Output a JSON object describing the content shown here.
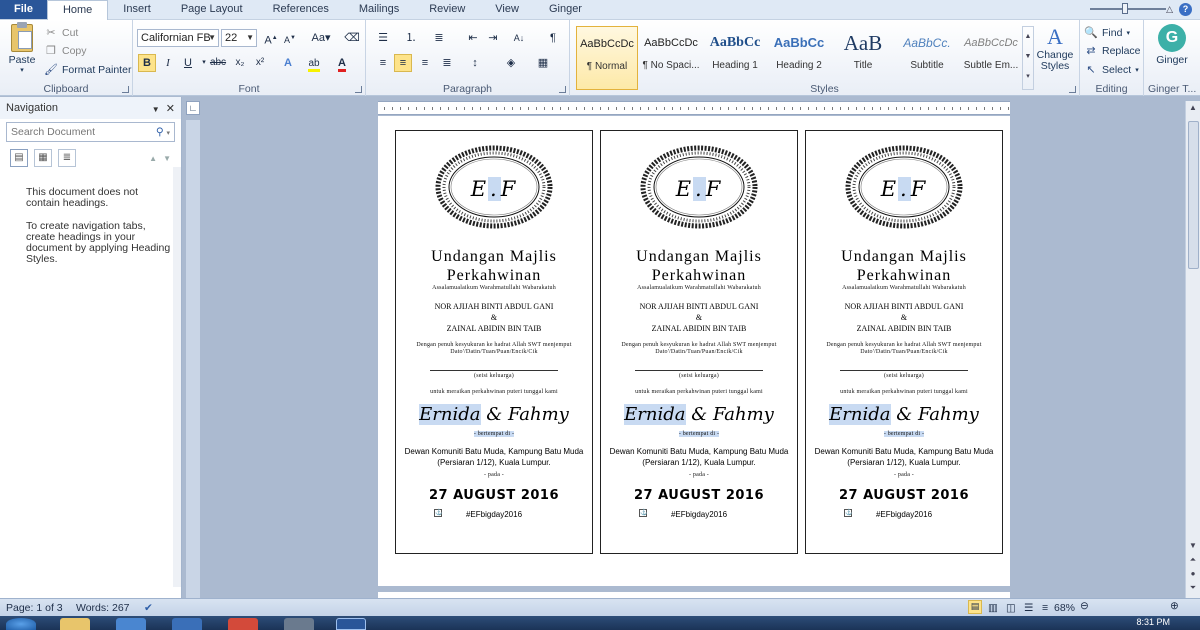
{
  "ribbon_tabs": [
    "File",
    "Home",
    "Insert",
    "Page Layout",
    "References",
    "Mailings",
    "Review",
    "View",
    "Ginger"
  ],
  "active_tab": "Home",
  "clipboard": {
    "paste": "Paste",
    "cut": "Cut",
    "copy": "Copy",
    "format_painter": "Format Painter",
    "label": "Clipboard"
  },
  "font": {
    "family": "Californian FB",
    "size": "22",
    "label": "Font"
  },
  "paragraph": {
    "label": "Paragraph"
  },
  "styles": {
    "label": "Styles",
    "items": [
      {
        "preview": "AaBbCcDc",
        "name": "¶ Normal"
      },
      {
        "preview": "AaBbCcDc",
        "name": "¶ No Spaci..."
      },
      {
        "preview": "AaBbCc",
        "name": "Heading 1"
      },
      {
        "preview": "AaBbCc",
        "name": "Heading 2"
      },
      {
        "preview": "AaB",
        "name": "Title"
      },
      {
        "preview": "AaBbCc.",
        "name": "Subtitle"
      },
      {
        "preview": "AaBbCcDc",
        "name": "Subtle Em..."
      }
    ],
    "change_styles": "Change Styles"
  },
  "editing": {
    "find": "Find",
    "replace": "Replace",
    "select": "Select",
    "label": "Editing"
  },
  "ginger": {
    "button": "Ginger",
    "label": "Ginger T..."
  },
  "navigation": {
    "title": "Navigation",
    "search_placeholder": "Search Document",
    "msg1": "This document does not contain headings.",
    "msg2": "To create navigation tabs, create headings in your document by applying Heading Styles."
  },
  "card": {
    "initials_left": "E",
    "initials_right": "F",
    "title1": "Undangan Majlis",
    "title2": "Perkahwinan",
    "greeting": "Assalamualaikum   Warahmatullahi   Wabarakatuh",
    "name1": "NOR AJIJAH BINTI ABDUL GANI",
    "amp": "&",
    "name2": "ZAINAL ABIDIN BIN TAIB",
    "invite_text": "Dengan penuh kesyukuran ke hadrat Allah SWT menjemput Dato'/Datin/Tuan/Puan/Encik/Cik",
    "family": "(seisi keluarga)",
    "purpose": "untuk meraikan perkahwinan puteri tunggal kami",
    "bride": "Ernida",
    "couple_amp": "&",
    "groom": "Fahmy",
    "located": "- bertempat di -",
    "venue": "Dewan Komuniti Batu Muda, Kampung Batu Muda (Persiaran 1/12), Kuala Lumpur.",
    "on": "- pada -",
    "date": "27 AUGUST 2016",
    "hashtag": "#EFbigday2016"
  },
  "status": {
    "page": "Page: 1 of 3",
    "words": "Words: 267",
    "zoom": "68%"
  },
  "taskbar": {
    "time": "8:31 PM"
  }
}
